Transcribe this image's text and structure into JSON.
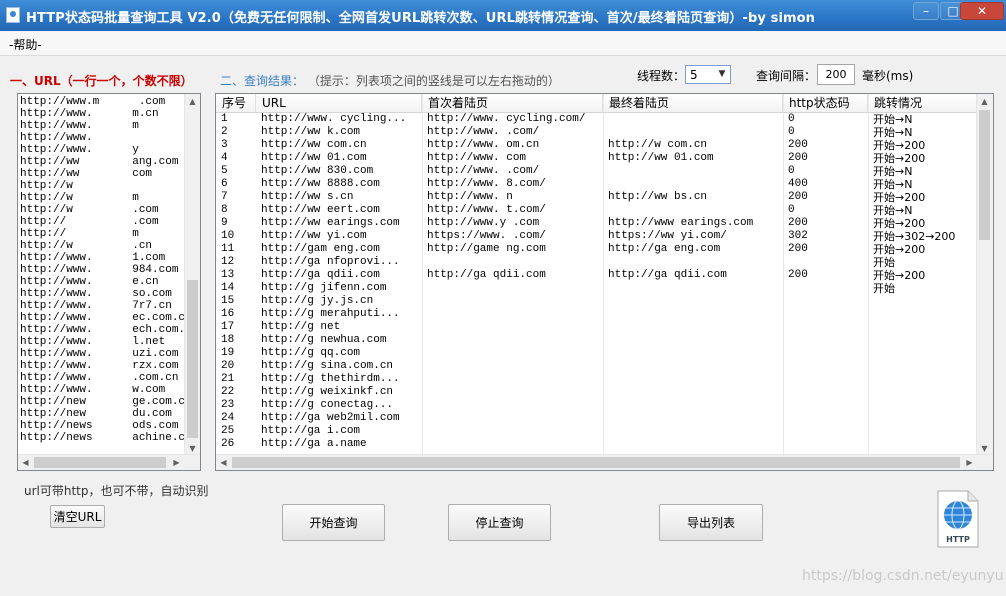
{
  "window": {
    "title": "HTTP状态码批量查询工具 V2.0（免费无任何限制、全网首发URL跳转次数、URL跳转情况查询、首次/最终着陆页查询）-by simon",
    "controls": {
      "minimize": "–",
      "maximize": "□",
      "close": "✕"
    }
  },
  "menu": {
    "help": "-帮助-"
  },
  "url_section": {
    "label": "一、URL（一行一个，个数不限）",
    "lines": [
      "http://www.m      .com",
      "http://www.      m.cn",
      "http://www.      m",
      "http://www.      ",
      "http://www.      y",
      "http://ww        ang.com",
      "http://ww        com",
      "http://w         ",
      "http://w         m",
      "http://w         .com",
      "http://          .com",
      "http://          m",
      "http://w         .cn",
      "http://www.      1.com",
      "http://www.      984.com",
      "http://www.      e.cn",
      "http://www.      so.com",
      "http://www.      7r7.cn",
      "http://www.      ec.com.cn",
      "http://www.      ech.com.cn",
      "http://www.      l.net",
      "http://www.      uzi.com",
      "http://www.      rzx.com",
      "http://www.      .com.cn",
      "http://www.      w.com",
      "http://new       ge.com.cn",
      "http://new       du.com",
      "http://news      ods.com",
      "http://news      achine.com"
    ],
    "hint": "url可带http，也可不带，自动识别",
    "clear_button": "清空URL"
  },
  "results_section": {
    "label": "二、查询结果：",
    "tip": "（提示：列表项之间的竖线是可以左右拖动的）",
    "columns": [
      "序号",
      "URL",
      "首次着陆页",
      "最终着陆页",
      "http状态码",
      "跳转情况"
    ],
    "rows": [
      [
        "1",
        "http://www.      cycling...",
        "http://www.      cycling.com/",
        "",
        "0",
        "开始→N"
      ],
      [
        "2",
        "http://ww       k.com",
        "http://www.      .com/",
        "",
        "0",
        "开始→N"
      ],
      [
        "3",
        "http://ww       com.cn",
        "http://www.      om.cn",
        "http://w      com.cn",
        "200",
        "开始→200"
      ],
      [
        "4",
        "http://ww       01.com",
        "http://www.      com",
        "http://ww      01.com",
        "200",
        "开始→200"
      ],
      [
        "5",
        "http://ww       830.com",
        "http://www.      .com/",
        "",
        "0",
        "开始→N"
      ],
      [
        "6",
        "http://ww       8888.com",
        "http://www.      8.com/",
        "",
        "400",
        "开始→N"
      ],
      [
        "7",
        "http://ww       s.cn",
        "http://www.      n",
        "http://ww      bs.cn",
        "200",
        "开始→200"
      ],
      [
        "8",
        "http://ww       eert.com",
        "http://www.      t.com/",
        "",
        "0",
        "开始→N"
      ],
      [
        "9",
        "http://ww       earings.com",
        "http://www.y      .com",
        "http://www      earings.com",
        "200",
        "开始→200"
      ],
      [
        "10",
        "http://ww       yi.com",
        "https://www.      .com/",
        "https://ww      yi.com/",
        "302",
        "开始→302→200"
      ],
      [
        "11",
        "http://gam      eng.com",
        "http://game      ng.com",
        "http://ga      eng.com",
        "200",
        "开始→200"
      ],
      [
        "12",
        "http://ga      nfoprovi...",
        "",
        "",
        "",
        "开始"
      ],
      [
        "13",
        "http://ga      qdii.com",
        "http://ga      qdii.com",
        "http://ga      qdii.com",
        "200",
        "开始→200"
      ],
      [
        "14",
        "http://g      jifenn.com",
        "",
        "",
        "",
        "开始"
      ],
      [
        "15",
        "http://g      jy.js.cn",
        "",
        "",
        "",
        ""
      ],
      [
        "16",
        "http://g      merahputi...",
        "",
        "",
        "",
        ""
      ],
      [
        "17",
        "http://g      net",
        "",
        "",
        "",
        ""
      ],
      [
        "18",
        "http://g      newhua.com",
        "",
        "",
        "",
        ""
      ],
      [
        "19",
        "http://g      qq.com",
        "",
        "",
        "",
        ""
      ],
      [
        "20",
        "http://g      sina.com.cn",
        "",
        "",
        "",
        ""
      ],
      [
        "21",
        "http://g      thethirdm...",
        "",
        "",
        "",
        ""
      ],
      [
        "22",
        "http://g      weixinkf.cn",
        "",
        "",
        "",
        ""
      ],
      [
        "23",
        "http://g      conectag...",
        "",
        "",
        "",
        ""
      ],
      [
        "24",
        "http://ga      web2mil.com",
        "",
        "",
        "",
        ""
      ],
      [
        "25",
        "http://ga      i.com",
        "",
        "",
        "",
        ""
      ],
      [
        "26",
        "http://ga      a.name",
        "",
        "",
        "",
        ""
      ]
    ]
  },
  "settings": {
    "threads_label": "线程数：",
    "threads_value": "5",
    "interval_label": "查询间隔：",
    "interval_value": "200",
    "interval_unit": "毫秒(ms)"
  },
  "buttons": {
    "start": "开始查询",
    "stop": "停止查询",
    "export": "导出列表"
  },
  "logo": {
    "text": "HTTP"
  },
  "watermark": "https://blog.csdn.net/eyunyu"
}
